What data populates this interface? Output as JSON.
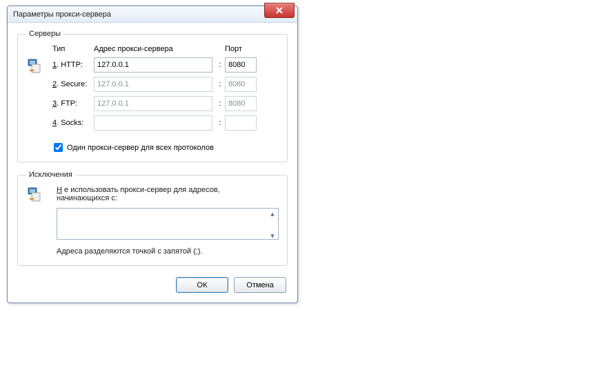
{
  "window_title": "Параметры прокси-сервера",
  "servers": {
    "legend": "Серверы",
    "headers": {
      "type": "Тип",
      "address": "Адрес прокси-сервера",
      "port": "Порт"
    },
    "rows": [
      {
        "num": "1",
        "label": "HTTP:",
        "addr": "127.0.0.1",
        "port": "8080",
        "enabled": true
      },
      {
        "num": "2",
        "label": "Secure:",
        "addr": "127.0.0.1",
        "port": "8080",
        "enabled": false
      },
      {
        "num": "3",
        "label": "FTP:",
        "addr": "127.0.0.1",
        "port": "8080",
        "enabled": false
      },
      {
        "num": "4",
        "label": "Socks:",
        "addr": "",
        "port": "",
        "enabled": false
      }
    ],
    "same_proxy_checked": true,
    "same_proxy_label": "Один прокси-сервер для всех протоколов"
  },
  "exceptions": {
    "legend": "Исключения",
    "label_line1": "Не использовать прокси-сервер для адресов,",
    "label_line2": "начинающихся с:",
    "value": "",
    "hint": "Адреса разделяются точкой с запятой (;)."
  },
  "buttons": {
    "ok": "ОК",
    "cancel": "Отмена"
  }
}
